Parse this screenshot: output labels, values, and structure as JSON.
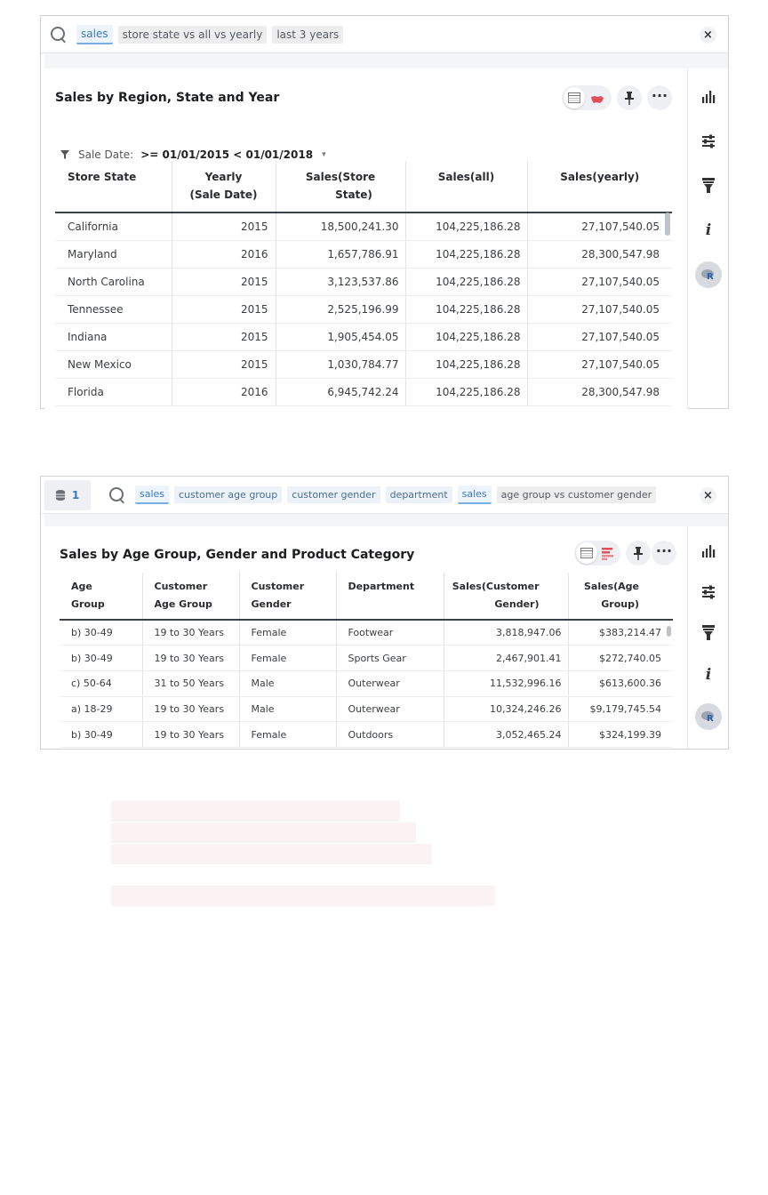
{
  "panel1": {
    "search_tokens": [
      {
        "text": "sales",
        "kind": "measure"
      },
      {
        "text": "store state vs all vs yearly",
        "kind": "keyword"
      },
      {
        "text": "last 3 years",
        "kind": "keyword"
      }
    ],
    "close_label": "×",
    "title": "Sales by Region, State and Year",
    "filter": {
      "label": "Sale Date:",
      "value": ">= 01/01/2015 < 01/01/2018",
      "caret": "▾"
    },
    "table": {
      "headers": [
        [
          "Store State",
          ""
        ],
        [
          "Yearly",
          "(Sale Date)"
        ],
        [
          "Sales(Store",
          "State)"
        ],
        [
          "Sales(all)",
          ""
        ],
        [
          "Sales(yearly)",
          ""
        ]
      ],
      "rows": [
        [
          "California",
          "2015",
          "18,500,241.30",
          "104,225,186.28",
          "27,107,540.05"
        ],
        [
          "Maryland",
          "2016",
          "1,657,786.91",
          "104,225,186.28",
          "28,300,547.98"
        ],
        [
          "North Carolina",
          "2015",
          "3,123,537.86",
          "104,225,186.28",
          "27,107,540.05"
        ],
        [
          "Tennessee",
          "2015",
          "2,525,196.99",
          "104,225,186.28",
          "27,107,540.05"
        ],
        [
          "Indiana",
          "2015",
          "1,905,454.05",
          "104,225,186.28",
          "27,107,540.05"
        ],
        [
          "New Mexico",
          "2015",
          "1,030,784.77",
          "104,225,186.28",
          "27,107,540.05"
        ],
        [
          "Florida",
          "2016",
          "6,945,742.24",
          "104,225,186.28",
          "28,300,547.98"
        ]
      ]
    }
  },
  "panel2": {
    "data_source_count": "1",
    "search_tokens": [
      {
        "text": "sales",
        "kind": "measure"
      },
      {
        "text": "customer age group",
        "kind": "attr"
      },
      {
        "text": "customer gender",
        "kind": "attr"
      },
      {
        "text": "department",
        "kind": "attr"
      },
      {
        "text": "sales",
        "kind": "measure"
      },
      {
        "text": "age group vs customer gender",
        "kind": "keyword"
      }
    ],
    "close_label": "×",
    "title": "Sales by Age Group, Gender and Product Category",
    "table": {
      "headers": [
        [
          "Age",
          "Group"
        ],
        [
          "Customer",
          "Age Group"
        ],
        [
          "Customer",
          "Gender"
        ],
        [
          "Department",
          ""
        ],
        [
          "Sales(Customer",
          "Gender)"
        ],
        [
          "Sales(Age",
          "Group)"
        ]
      ],
      "rows": [
        [
          "b) 30-49",
          "19 to 30 Years",
          "Female",
          "Footwear",
          "3,818,947.06",
          "$383,214.47"
        ],
        [
          "b) 30-49",
          "19 to 30 Years",
          "Female",
          "Sports Gear",
          "2,467,901.41",
          "$272,740.05"
        ],
        [
          "c) 50-64",
          "31 to 50 Years",
          "Male",
          "Outerwear",
          "11,532,996.16",
          "$613,600.36"
        ],
        [
          "a) 18-29",
          "19 to 30 Years",
          "Male",
          "Outerwear",
          "10,324,246.26",
          "$9,179,745.54"
        ],
        [
          "b) 30-49",
          "19 to 30 Years",
          "Female",
          "Outdoors",
          "3,052,465.24",
          "$324,199.39"
        ]
      ]
    }
  },
  "sidebar_icons": [
    "bar-chart-icon",
    "settings-sliders-icon",
    "brush-icon",
    "info-icon",
    "r-analysis-icon"
  ],
  "more_label": "···",
  "colors": {
    "accent": "#3a78c2",
    "measure_underline": "#79aee3",
    "map_icon": "#e0505b",
    "placeholder": "#faf2f3"
  }
}
